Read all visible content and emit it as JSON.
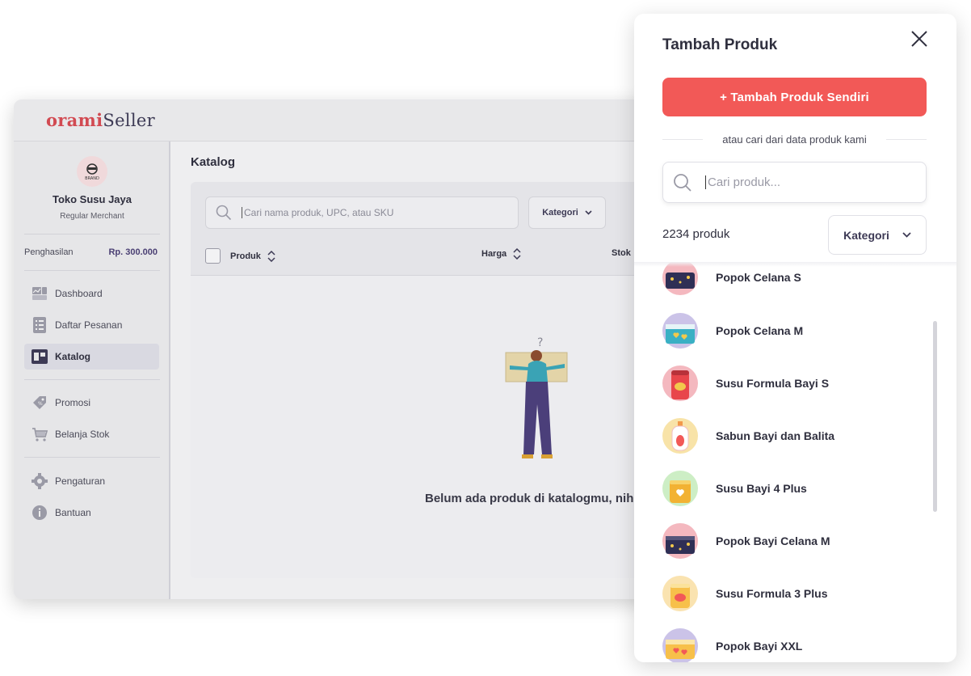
{
  "app": {
    "logo": {
      "part1": "orami",
      "part2": "Seller"
    },
    "store": {
      "avatar_text": "BRAND",
      "name": "Toko Susu Jaya",
      "type": "Regular Merchant"
    },
    "earnings": {
      "label": "Penghasilan",
      "value": "Rp. 300.000"
    },
    "nav": [
      {
        "label": "Dashboard",
        "icon": "dashboard-icon"
      },
      {
        "label": "Daftar Pesanan",
        "icon": "order-list-icon"
      },
      {
        "label": "Katalog",
        "icon": "catalog-icon",
        "active": true
      },
      {
        "label": "Promosi",
        "icon": "promo-tag-icon"
      },
      {
        "label": "Belanja Stok",
        "icon": "cart-icon"
      },
      {
        "label": "Pengaturan",
        "icon": "gear-icon"
      },
      {
        "label": "Bantuan",
        "icon": "info-icon"
      }
    ],
    "main": {
      "title": "Katalog",
      "search_placeholder": "Cari nama produk, UPC, atau SKU",
      "category_label": "Kategori",
      "columns": [
        "Produk",
        "Harga",
        "Stok"
      ],
      "empty_text": "Belum ada produk di katalogmu, nih"
    }
  },
  "panel": {
    "title": "Tambah Produk",
    "add_button": "+ Tambah Produk Sendiri",
    "or_text": "atau cari dari data produk kami",
    "search_placeholder": "Cari produk...",
    "count": "2234 produk",
    "category_label": "Kategori",
    "products": [
      {
        "name": "Popok Celana S",
        "thumb": "diaper-night"
      },
      {
        "name": "Popok Celana M",
        "thumb": "diaper-hearts-blue"
      },
      {
        "name": "Susu Formula Bayi S",
        "thumb": "formula-can-red"
      },
      {
        "name": "Sabun Bayi dan Balita",
        "thumb": "soap-bottle"
      },
      {
        "name": "Susu Bayi 4 Plus",
        "thumb": "formula-can-yellow"
      },
      {
        "name": "Popok Bayi Celana M",
        "thumb": "diaper-night"
      },
      {
        "name": "Susu Formula 3 Plus",
        "thumb": "formula-can-orange"
      },
      {
        "name": "Popok Bayi XXL",
        "thumb": "diaper-hearts-yellow"
      }
    ]
  },
  "colors": {
    "accent_red": "#f25957",
    "brand_purple": "#3d3a55",
    "logo_red": "#d24a52"
  }
}
